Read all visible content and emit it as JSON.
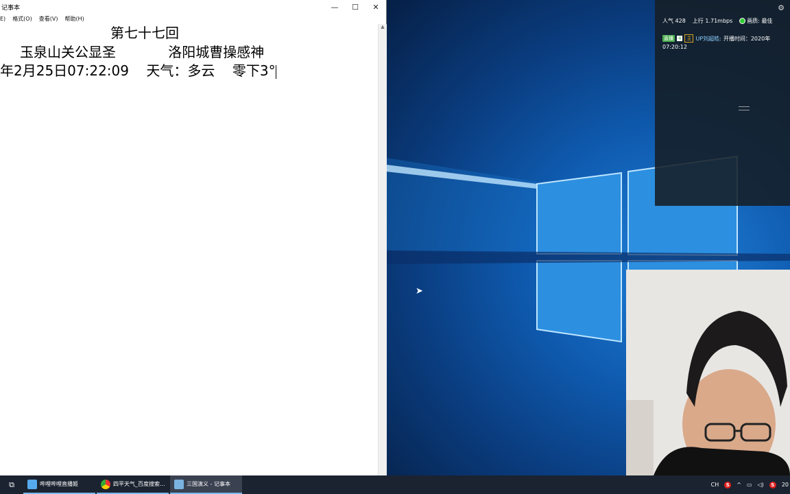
{
  "notepad": {
    "title": "记事本",
    "menu": [
      "E)",
      "格式(O)",
      "查看(V)",
      "帮助(H)"
    ],
    "lines": [
      "第七十七回",
      "玉泉山关公显圣            洛阳城曹操感神",
      "年2月25日07:22:09    天气：多云    零下3°"
    ],
    "minimize_label": "—",
    "maximize_label": "☐",
    "close_label": "✕"
  },
  "overlay": {
    "popularity": "人气  428",
    "upload": "上行  1.71mbps",
    "quality": "画质: 最佳",
    "level_badge": "直播",
    "level_num": "4",
    "host_badge": "主",
    "up_name": "UP刘超皓:",
    "start_time_label": "开播时间：2020年",
    "start_time_value": "07:20:12"
  },
  "taskbar": {
    "items": [
      {
        "label": "哔哩哔哩直播姬",
        "color": "#55aaee"
      },
      {
        "label": "四平天气_百度搜索...",
        "color": "#e8b400"
      },
      {
        "label": "三国演义 - 记事本",
        "color": "#7ab3e0"
      }
    ],
    "tray": {
      "ime": "CH",
      "s_label": "S",
      "clock": "20"
    }
  },
  "colors": {
    "taskbar_bg": "#1b2330",
    "accent": "#76b9ed"
  }
}
